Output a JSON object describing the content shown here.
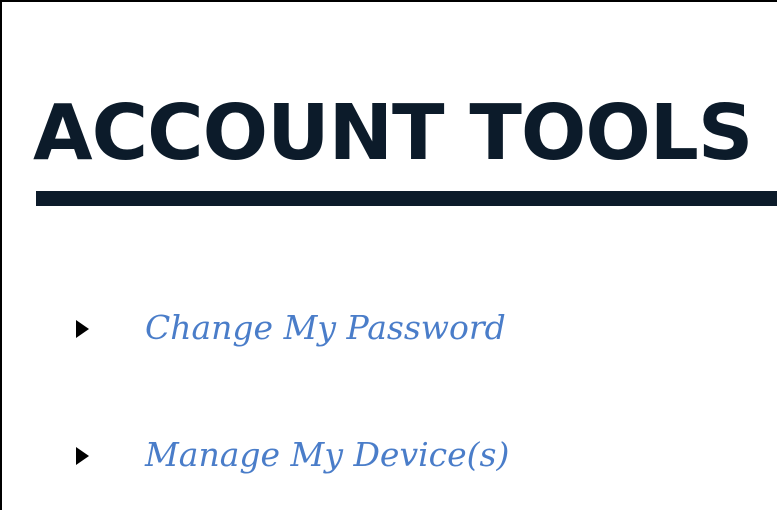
{
  "page": {
    "title": "ACCOUNT TOOLS"
  },
  "tools": [
    {
      "label": "Change My Password",
      "icon": "triangle-right-icon"
    },
    {
      "label": "Manage My Device(s)",
      "icon": "triangle-right-icon"
    }
  ],
  "colors": {
    "title": "#0c1b2a",
    "link": "#4a7dc9",
    "bullet": "#000000",
    "border": "#000000"
  }
}
